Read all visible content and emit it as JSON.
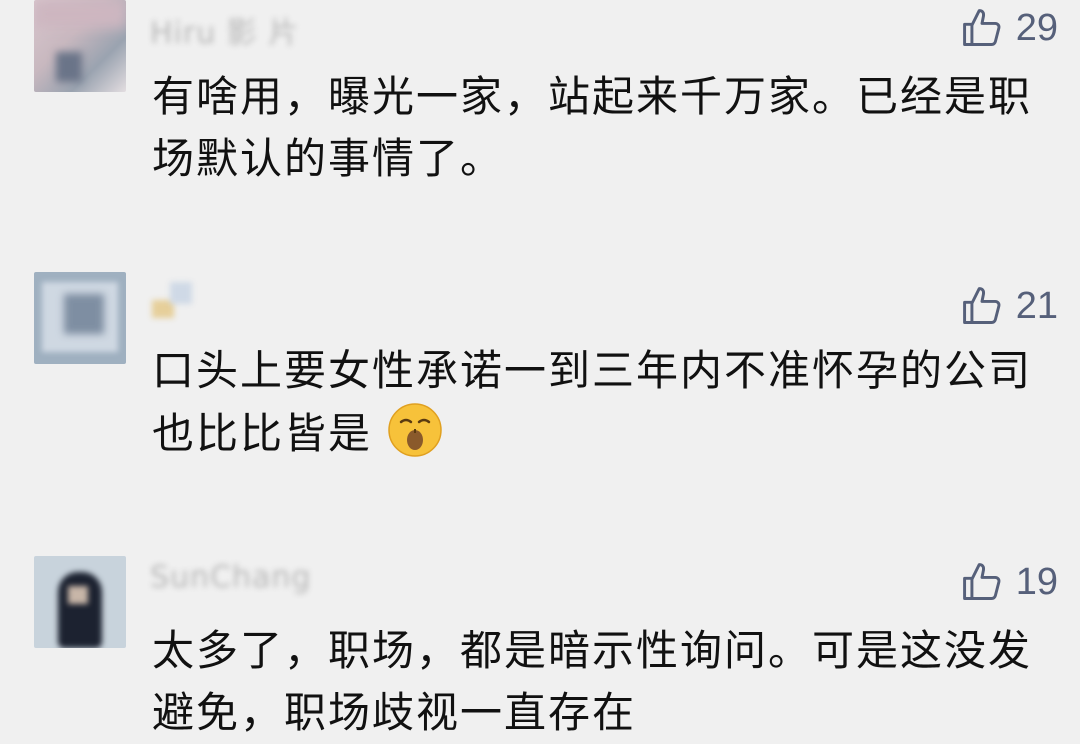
{
  "comments": [
    {
      "username": "Hiru 影 片",
      "likes": "29",
      "text": "有啥用，曝光一家，站起来千万家。已经是职场默认的事情了。"
    },
    {
      "username": "",
      "likes": "21",
      "text": "口头上要女性承诺一到三年内不准怀孕的公司也比比皆是"
    },
    {
      "username": "SunChang",
      "likes": "19",
      "text": "太多了，职场，都是暗示性询问。可是这没发避免，职场歧视一直存在"
    }
  ],
  "icons": {
    "like": "thumbs-up-icon",
    "emoji": "sleepy-face-emoji"
  },
  "colors": {
    "background": "#f0f0f0",
    "like": "#56607a",
    "text": "#111111"
  }
}
